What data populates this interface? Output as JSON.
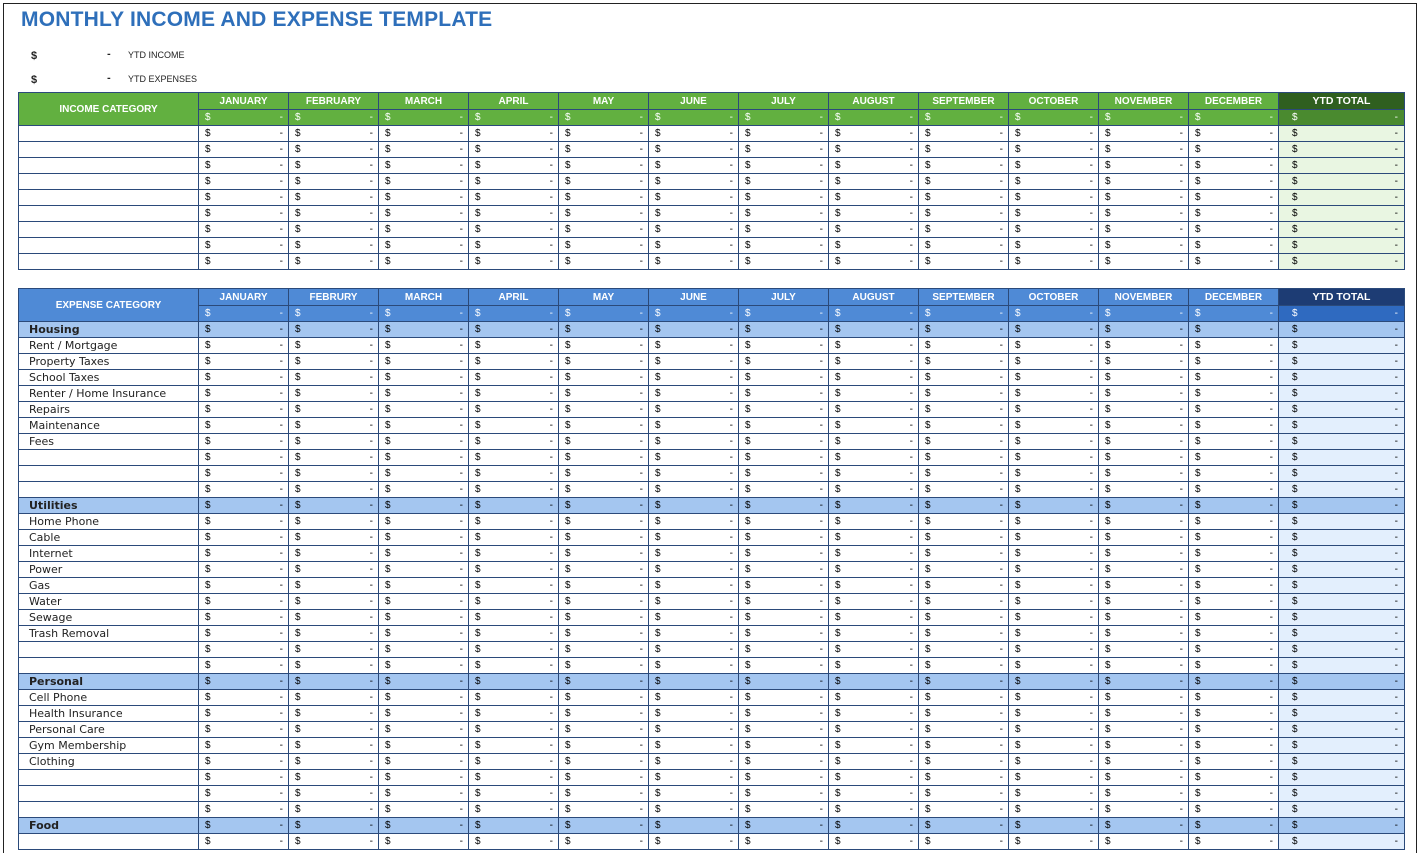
{
  "title": "MONTHLY INCOME AND EXPENSE TEMPLATE",
  "summary": [
    {
      "currency": "$",
      "value": "-",
      "label": "YTD INCOME"
    },
    {
      "currency": "$",
      "value": "-",
      "label": "YTD EXPENSES"
    }
  ],
  "currency_symbol": "$",
  "empty_value": "-",
  "colors": {
    "title": "#2e6fba",
    "income_header": "#62b040",
    "income_ytd_header": "#2f5f1f",
    "income_ytd_body": "#e9f6e2",
    "expense_header": "#4f8ad6",
    "expense_ytd_header": "#1d3c74",
    "expense_group_row": "#a4c6f0",
    "expense_ytd_body": "#e3effd",
    "grid": "#2b4a7a"
  },
  "income": {
    "category_header": "INCOME CATEGORY",
    "months": [
      "JANUARY",
      "FEBRUARY",
      "MARCH",
      "APRIL",
      "MAY",
      "JUNE",
      "JULY",
      "AUGUST",
      "SEPTEMBER",
      "OCTOBER",
      "NOVEMBER",
      "DECEMBER"
    ],
    "ytd_header": "YTD TOTAL",
    "rows": [
      "",
      "",
      "",
      "",
      "",
      "",
      "",
      "",
      ""
    ]
  },
  "expense": {
    "category_header": "EXPENSE CATEGORY",
    "months": [
      "JANUARY",
      "FEBRURY",
      "MARCH",
      "APRIL",
      "MAY",
      "JUNE",
      "JULY",
      "AUGUST",
      "SEPTEMBER",
      "OCTOBER",
      "NOVEMBER",
      "DECEMBER"
    ],
    "ytd_header": "YTD TOTAL",
    "rows": [
      {
        "label": "Housing",
        "group": true
      },
      {
        "label": "Rent / Mortgage",
        "group": false
      },
      {
        "label": "Property Taxes",
        "group": false
      },
      {
        "label": "School Taxes",
        "group": false
      },
      {
        "label": "Renter / Home Insurance",
        "group": false
      },
      {
        "label": "Repairs",
        "group": false
      },
      {
        "label": "Maintenance",
        "group": false
      },
      {
        "label": "Fees",
        "group": false
      },
      {
        "label": "",
        "group": false
      },
      {
        "label": "",
        "group": false
      },
      {
        "label": "",
        "group": false
      },
      {
        "label": "Utilities",
        "group": true
      },
      {
        "label": "Home Phone",
        "group": false
      },
      {
        "label": "Cable",
        "group": false
      },
      {
        "label": "Internet",
        "group": false
      },
      {
        "label": "Power",
        "group": false
      },
      {
        "label": "Gas",
        "group": false
      },
      {
        "label": "Water",
        "group": false
      },
      {
        "label": "Sewage",
        "group": false
      },
      {
        "label": "Trash Removal",
        "group": false
      },
      {
        "label": "",
        "group": false
      },
      {
        "label": "",
        "group": false
      },
      {
        "label": "Personal",
        "group": true
      },
      {
        "label": "Cell Phone",
        "group": false
      },
      {
        "label": "Health Insurance",
        "group": false
      },
      {
        "label": "Personal Care",
        "group": false
      },
      {
        "label": "Gym Membership",
        "group": false
      },
      {
        "label": "Clothing",
        "group": false
      },
      {
        "label": "",
        "group": false
      },
      {
        "label": "",
        "group": false
      },
      {
        "label": "",
        "group": false
      },
      {
        "label": "Food",
        "group": true
      },
      {
        "label": "",
        "group": false
      }
    ]
  }
}
